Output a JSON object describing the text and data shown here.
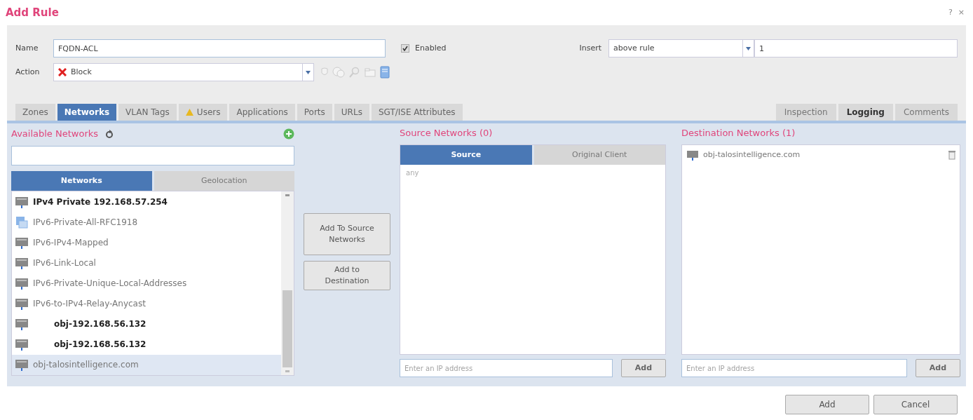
{
  "window": {
    "title": "Add Rule",
    "help": "?",
    "close": "×"
  },
  "form": {
    "name_label": "Name",
    "name_value": "FQDN-ACL",
    "enabled_label": "Enabled",
    "enabled": true,
    "insert_label": "Insert",
    "insert_value": "above rule",
    "insert_rule": "1",
    "action_label": "Action",
    "action_value": "Block"
  },
  "tabs": [
    {
      "label": "Zones",
      "selected": false,
      "warning": false
    },
    {
      "label": "Networks",
      "selected": true,
      "warning": false
    },
    {
      "label": "VLAN Tags",
      "selected": false,
      "warning": false
    },
    {
      "label": "Users",
      "selected": false,
      "warning": true
    },
    {
      "label": "Applications",
      "selected": false,
      "warning": false
    },
    {
      "label": "Ports",
      "selected": false,
      "warning": false
    },
    {
      "label": "URLs",
      "selected": false,
      "warning": false
    },
    {
      "label": "SGT/ISE Attributes",
      "selected": false,
      "warning": false
    }
  ],
  "right_tabs": [
    {
      "label": "Inspection",
      "selected": false
    },
    {
      "label": "Logging",
      "selected": true
    },
    {
      "label": "Comments",
      "selected": false
    }
  ],
  "available": {
    "title": "Available Networks",
    "subtabs": [
      {
        "label": "Networks",
        "selected": true
      },
      {
        "label": "Geolocation",
        "selected": false
      }
    ],
    "items": [
      {
        "label": "IPv4 Private 192.168.57.254",
        "kind": "network",
        "bold": true,
        "indent": false,
        "selected": false
      },
      {
        "label": "IPv6-Private-All-RFC1918",
        "kind": "group",
        "bold": false,
        "indent": false,
        "selected": false
      },
      {
        "label": "IPv6-IPv4-Mapped",
        "kind": "network",
        "bold": false,
        "indent": false,
        "selected": false
      },
      {
        "label": "IPv6-Link-Local",
        "kind": "network",
        "bold": false,
        "indent": false,
        "selected": false
      },
      {
        "label": "IPv6-Private-Unique-Local-Addresses",
        "kind": "network",
        "bold": false,
        "indent": false,
        "selected": false
      },
      {
        "label": "IPv6-to-IPv4-Relay-Anycast",
        "kind": "network",
        "bold": false,
        "indent": false,
        "selected": false
      },
      {
        "label": "obj-192.168.56.132",
        "kind": "network",
        "bold": true,
        "indent": true,
        "selected": false
      },
      {
        "label": "obj-192.168.56.132",
        "kind": "network",
        "bold": true,
        "indent": true,
        "selected": false
      },
      {
        "label": "obj-talosintelligence.com",
        "kind": "network",
        "bold": false,
        "indent": false,
        "selected": true
      }
    ]
  },
  "middle_buttons": [
    "Add To Source Networks",
    "Add to Destination"
  ],
  "source": {
    "title": "Source Networks (0)",
    "subtabs": [
      {
        "label": "Source",
        "selected": true
      },
      {
        "label": "Original Client",
        "selected": false
      }
    ],
    "items": [
      "any"
    ],
    "placeholder": "Enter an IP address",
    "add": "Add"
  },
  "destination": {
    "title": "Destination Networks (1)",
    "items": [
      "obj-talosintelligence.com"
    ],
    "placeholder": "Enter an IP address",
    "add": "Add"
  },
  "buttons": [
    "Add",
    "Cancel"
  ]
}
